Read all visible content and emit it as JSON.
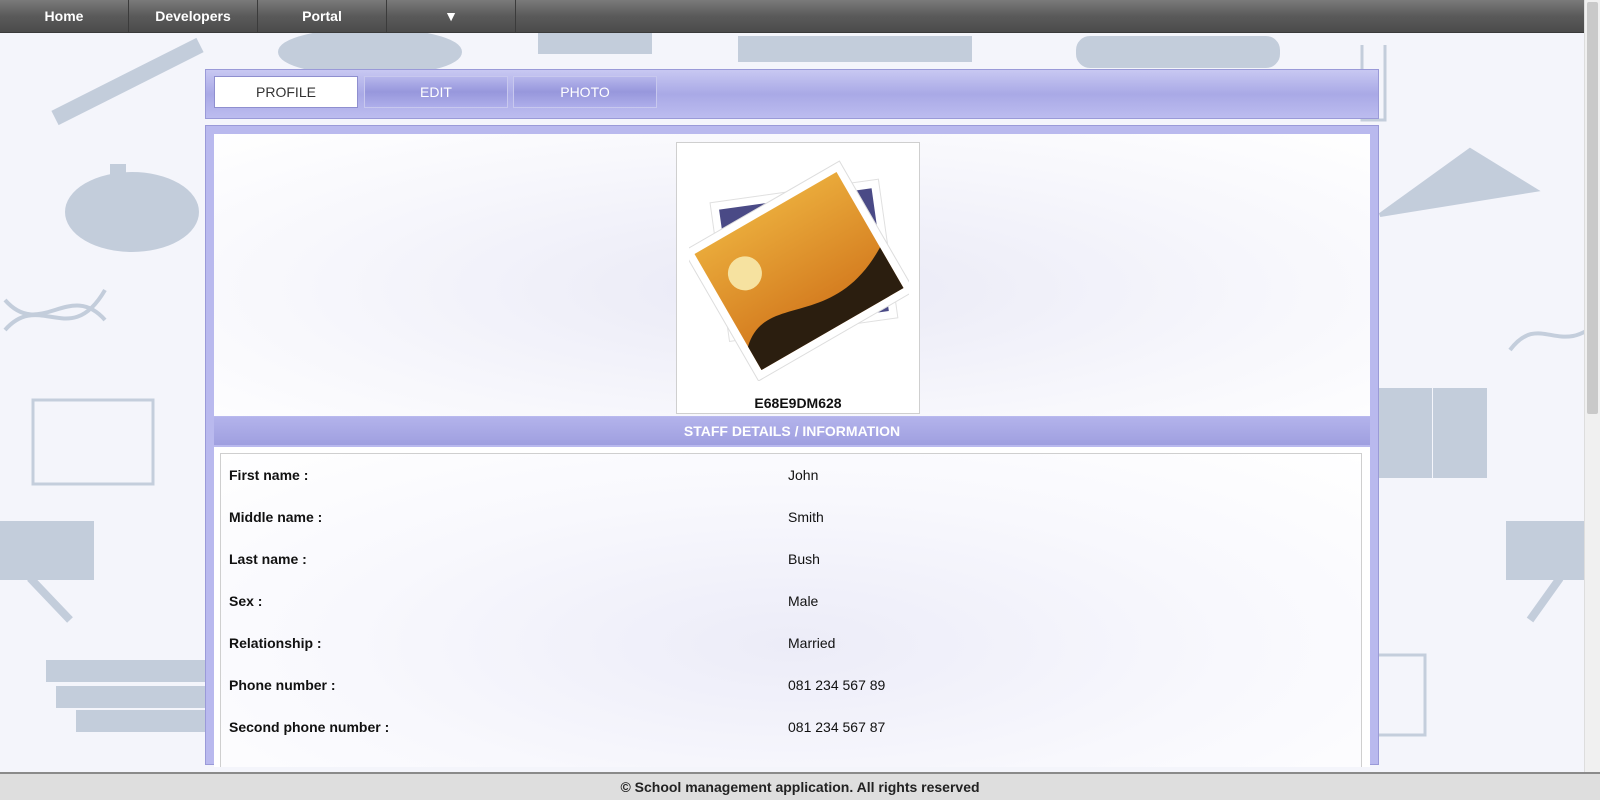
{
  "nav": {
    "items": [
      {
        "label": "Home"
      },
      {
        "label": "Developers"
      },
      {
        "label": "Portal"
      },
      {
        "label": "▼"
      }
    ]
  },
  "tabs": [
    {
      "label": "PROFILE",
      "active": true
    },
    {
      "label": "EDIT",
      "active": false
    },
    {
      "label": "PHOTO",
      "active": false
    }
  ],
  "profile": {
    "photo_icon": "image-placeholder-icon",
    "staff_id": "E68E9DM628"
  },
  "details": {
    "header": "STAFF DETAILS / INFORMATION",
    "rows": [
      {
        "label": "First name :",
        "value": "John"
      },
      {
        "label": "Middle name :",
        "value": "Smith"
      },
      {
        "label": "Last name :",
        "value": "Bush"
      },
      {
        "label": "Sex :",
        "value": "Male"
      },
      {
        "label": "Relationship :",
        "value": "Married"
      },
      {
        "label": "Phone number :",
        "value": "081 234 567 89"
      },
      {
        "label": "Second phone number :",
        "value": "081 234 567 87"
      }
    ]
  },
  "footer": {
    "text": "© School management application. All rights reserved"
  },
  "colors": {
    "accent": "#a9a9e6",
    "nav_bg": "#5a5a5a"
  }
}
